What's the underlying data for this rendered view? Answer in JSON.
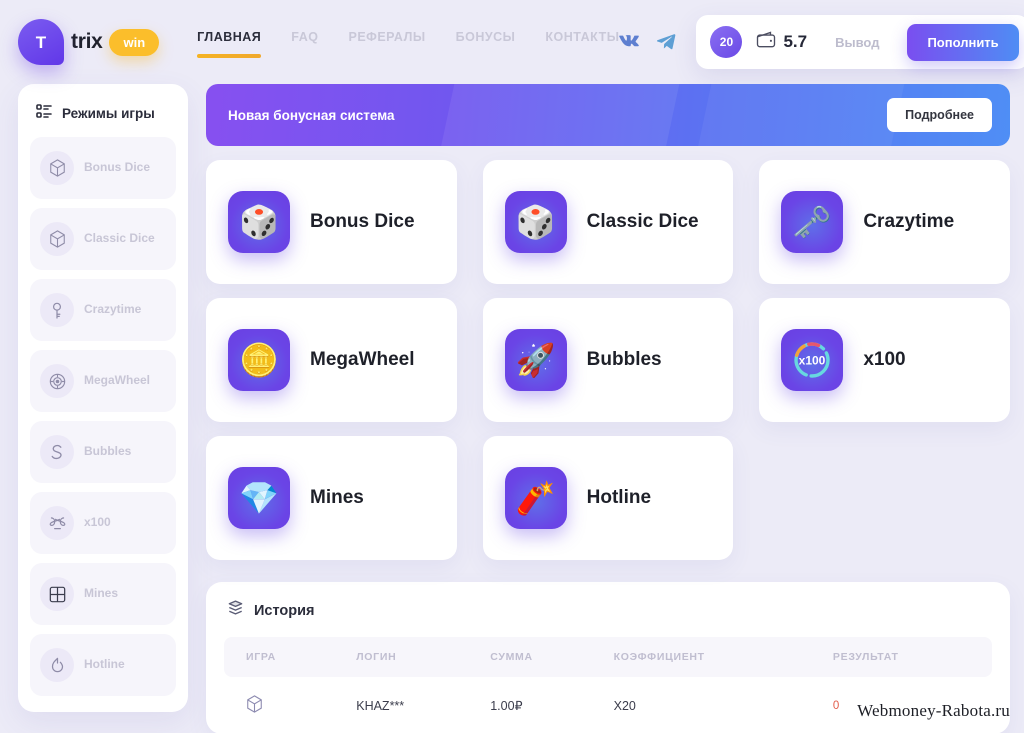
{
  "brand": {
    "mark_letter": "T",
    "name": "trix",
    "pill": "win"
  },
  "nav": {
    "items": [
      {
        "label": "ГЛАВНАЯ",
        "active": true
      },
      {
        "label": "FAQ",
        "active": false
      },
      {
        "label": "РЕФЕРАЛЫ",
        "active": false
      },
      {
        "label": "БОНУСЫ",
        "active": false
      },
      {
        "label": "КОНТАКТЫ",
        "active": false
      }
    ]
  },
  "social": {
    "vk": "vk-icon",
    "telegram": "telegram-icon"
  },
  "account": {
    "level": "20",
    "wallet_icon": "wallet-icon",
    "balance": "5.7",
    "withdraw_label": "Вывод",
    "deposit_label": "Пополнить"
  },
  "sidebar": {
    "icon": "list-menu-icon",
    "title": "Режимы игры",
    "items": [
      {
        "label": "Bonus Dice",
        "icon": "dice-hexagon-icon"
      },
      {
        "label": "Classic Dice",
        "icon": "dice-hexagon-icon"
      },
      {
        "label": "Crazytime",
        "icon": "key-icon"
      },
      {
        "label": "MegaWheel",
        "icon": "wheel-icon"
      },
      {
        "label": "Bubbles",
        "icon": "bubble-s-icon"
      },
      {
        "label": "x100",
        "icon": "x100-icon"
      },
      {
        "label": "Mines",
        "icon": "grid-mines-icon"
      },
      {
        "label": "Hotline",
        "icon": "flame-icon"
      }
    ]
  },
  "banner": {
    "title": "Новая бонусная система",
    "button": "Подробнее"
  },
  "games": [
    {
      "name": "Bonus Dice",
      "glyph": "🎲",
      "icon": "dice-icon"
    },
    {
      "name": "Classic Dice",
      "glyph": "🎲",
      "icon": "dice-icon"
    },
    {
      "name": "Crazytime",
      "glyph": "🗝",
      "icon": "key-icon"
    },
    {
      "name": "MegaWheel",
      "glyph": "🪙",
      "icon": "coin-wheel-icon"
    },
    {
      "name": "Bubbles",
      "glyph": "🚀",
      "icon": "rocket-icon"
    },
    {
      "name": "x100",
      "glyph": "x100",
      "icon": "x100-ring-icon"
    },
    {
      "name": "Mines",
      "glyph": "💎",
      "icon": "diamond-icon"
    },
    {
      "name": "Hotline",
      "glyph": "🧨",
      "icon": "dynamite-icon"
    }
  ],
  "history": {
    "icon": "layers-icon",
    "title": "История",
    "columns": [
      "ИГРА",
      "ЛОГИН",
      "СУММА",
      "КОЭФФИЦИЕНТ",
      "РЕЗУЛЬТАТ"
    ],
    "rows": [
      {
        "game_icon": "dice-hexagon-icon",
        "login": "KHAZ***",
        "amount": "1.00₽",
        "coefficient": "X20",
        "result": "0"
      }
    ]
  },
  "watermark": "Webmoney-Rabota.ru",
  "colors": {
    "page_bg": "#ecebf7",
    "accent_purple": "#6a45e6",
    "accent_yellow": "#fbbe2b",
    "deposit_gradient_from": "#7a4ef0",
    "deposit_gradient_to": "#4f8df4",
    "negative_red": "#e35d4b"
  }
}
